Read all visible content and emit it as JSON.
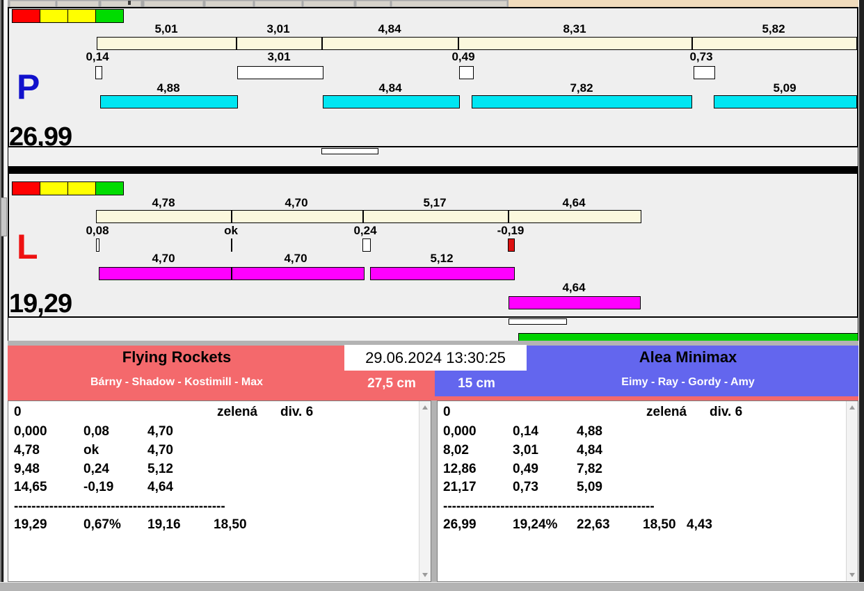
{
  "timestamp": "29.06.2024 13:30:25",
  "panel_p": {
    "id": "P",
    "total": "26,99",
    "scale": [
      "5,01",
      "3,01",
      "4,84",
      "8,31",
      "5,82"
    ],
    "gaps": [
      "0,14",
      "3,01",
      "0,49",
      "0,73"
    ],
    "bars": [
      "4,88",
      "4,84",
      "7,82",
      "5,09"
    ]
  },
  "panel_l": {
    "id": "L",
    "total": "19,29",
    "scale": [
      "4,78",
      "4,70",
      "5,17",
      "4,64"
    ],
    "gaps": [
      "0,08",
      "ok",
      "0,24",
      "-0,19"
    ],
    "bars": [
      "4,70",
      "4,70",
      "5,12"
    ],
    "bar2": "4,64"
  },
  "team_left": {
    "name": "Flying Rockets",
    "members": "Bárny - Shadow - Kostimill - Max",
    "distance": "27,5 cm",
    "log": {
      "first": "0",
      "color": "zelená",
      "division": "div. 6",
      "rows": [
        [
          "0,000",
          "0,08",
          "4,70"
        ],
        [
          "4,78",
          "ok",
          "4,70"
        ],
        [
          "9,48",
          "0,24",
          "5,12"
        ],
        [
          "14,65",
          "-0,19",
          "4,64"
        ]
      ],
      "divider": "------------------------------------------------",
      "totals": [
        "19,29",
        "0,67%",
        "19,16",
        "18,50"
      ]
    }
  },
  "team_right": {
    "name": "Alea Minimax",
    "members": "Eimy - Ray - Gordy - Amy",
    "distance": "15 cm",
    "log": {
      "first": "0",
      "color": "zelená",
      "division": "div. 6",
      "rows": [
        [
          "0,000",
          "0,14",
          "4,88"
        ],
        [
          "8,02",
          "3,01",
          "4,84"
        ],
        [
          "12,86",
          "0,49",
          "7,82"
        ],
        [
          "21,17",
          "0,73",
          "5,09"
        ]
      ],
      "divider": "------------------------------------------------",
      "totals": [
        "26,99",
        "19,24%",
        "22,63",
        "18,50",
        "4,43"
      ]
    }
  },
  "colors": {
    "panel_bg": "#EFEFEF",
    "scale_cream": "#FBF8DD",
    "bar_cyan": "#00E6F2",
    "bar_magenta": "#FF00FF",
    "negative_red": "#DD1111",
    "indicator_red": "#FF0000",
    "indicator_yellow": "#FFFF00",
    "indicator_green": "#00DC00",
    "green_bar": "#00D300",
    "lane_p_letter": "#1111CC",
    "lane_l_letter": "#EE1111",
    "team_left_bg": "#F4696C",
    "team_right_bg": "#6366EE",
    "chrome_gray": "#A9A9A9",
    "chrome_peach": "#F1DCBD",
    "band_gray": "#B3B3B3"
  }
}
